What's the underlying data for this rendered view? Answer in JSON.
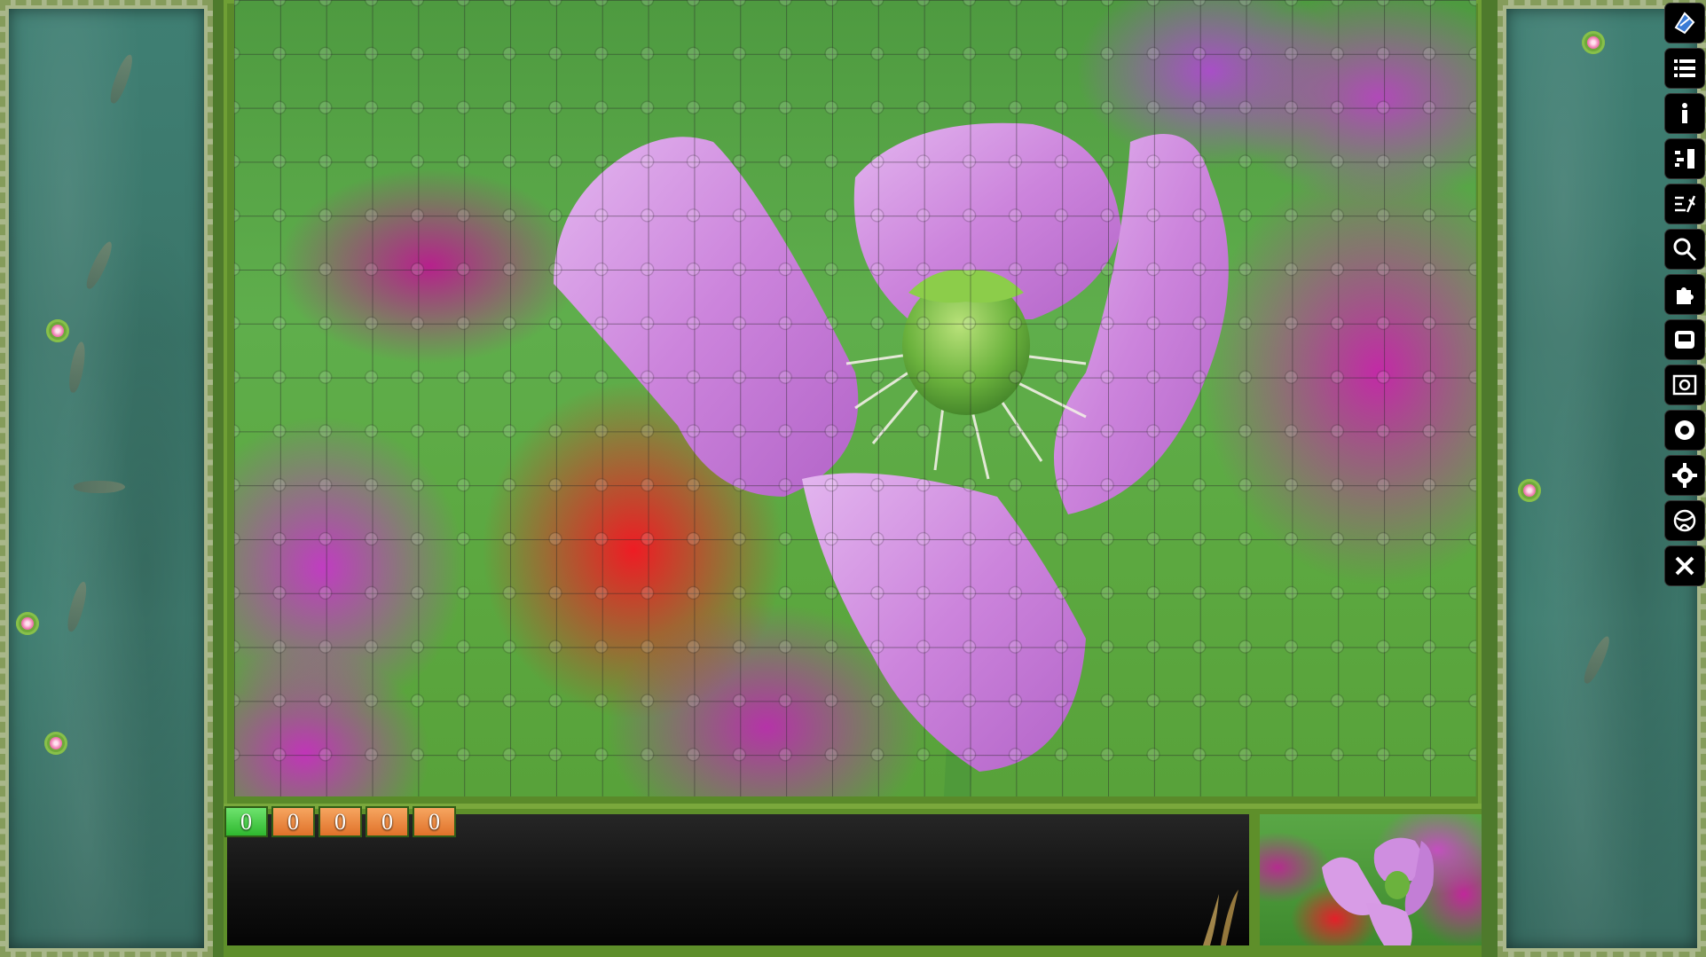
{
  "scores": [
    "0",
    "0",
    "0",
    "0",
    "0"
  ],
  "toolbar": [
    "puzzle-logo-icon",
    "menu-list-icon",
    "info-icon",
    "scatter-pieces-icon",
    "sort-edges-icon",
    "magnify-icon",
    "puzzle-piece-icon",
    "ghost-image-icon",
    "screenshot-icon",
    "background-icon",
    "settings-gear-icon",
    "globe-icon",
    "close-x-icon"
  ],
  "colors": {
    "board_green": "#5fae4c",
    "petal_lilac": "#d08ee0",
    "score_green": "#2fb82f",
    "score_orange": "#e0722a",
    "frame_green": "#5e8f2a"
  }
}
